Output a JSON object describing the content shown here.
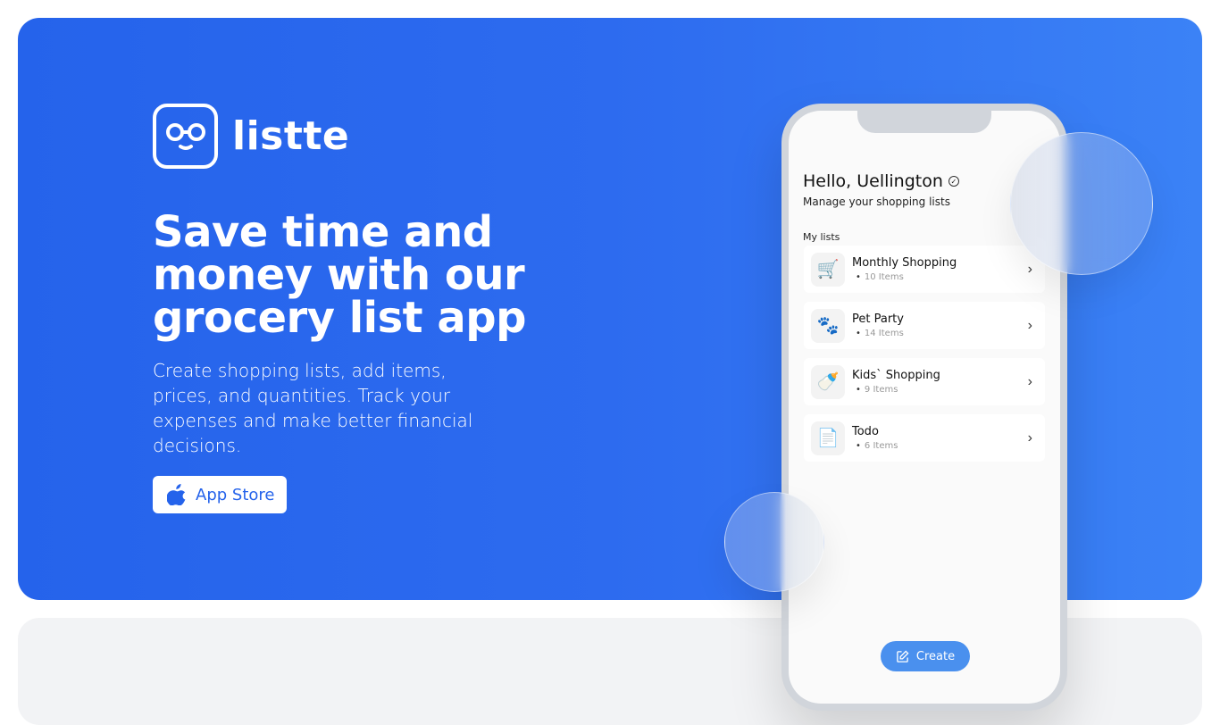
{
  "brand": {
    "name": "listte",
    "logo_icon": "glasses-face-icon",
    "primary_color": "#2563eb",
    "accent_color": "#3b82f6"
  },
  "hero": {
    "headline": "Save time and money with our grocery list app",
    "description": "Create shopping lists, add items, prices, and quantities. Track your expenses and make better financial decisions.",
    "cta": {
      "label": "App Store",
      "icon": "apple-icon"
    }
  },
  "phone": {
    "greeting": "Hello, Uellington",
    "verified_icon": "check-circle-icon",
    "subtitle": "Manage your shopping lists",
    "section_label": "My lists",
    "lists": [
      {
        "name": "Monthly Shopping",
        "count": "10 Items",
        "icon": "cart-icon",
        "glyph": "🛒"
      },
      {
        "name": "Pet Party",
        "count": "14 Items",
        "icon": "paw-icon",
        "glyph": "🐾"
      },
      {
        "name": "Kids` Shopping",
        "count": "9 Items",
        "icon": "baby-bottle-icon",
        "glyph": "🍼"
      },
      {
        "name": "Todo",
        "count": "6 Items",
        "icon": "document-icon",
        "glyph": "📄"
      }
    ],
    "chevron": "›",
    "bullet": "•",
    "create_button": {
      "label": "Create",
      "icon": "edit-icon"
    }
  }
}
